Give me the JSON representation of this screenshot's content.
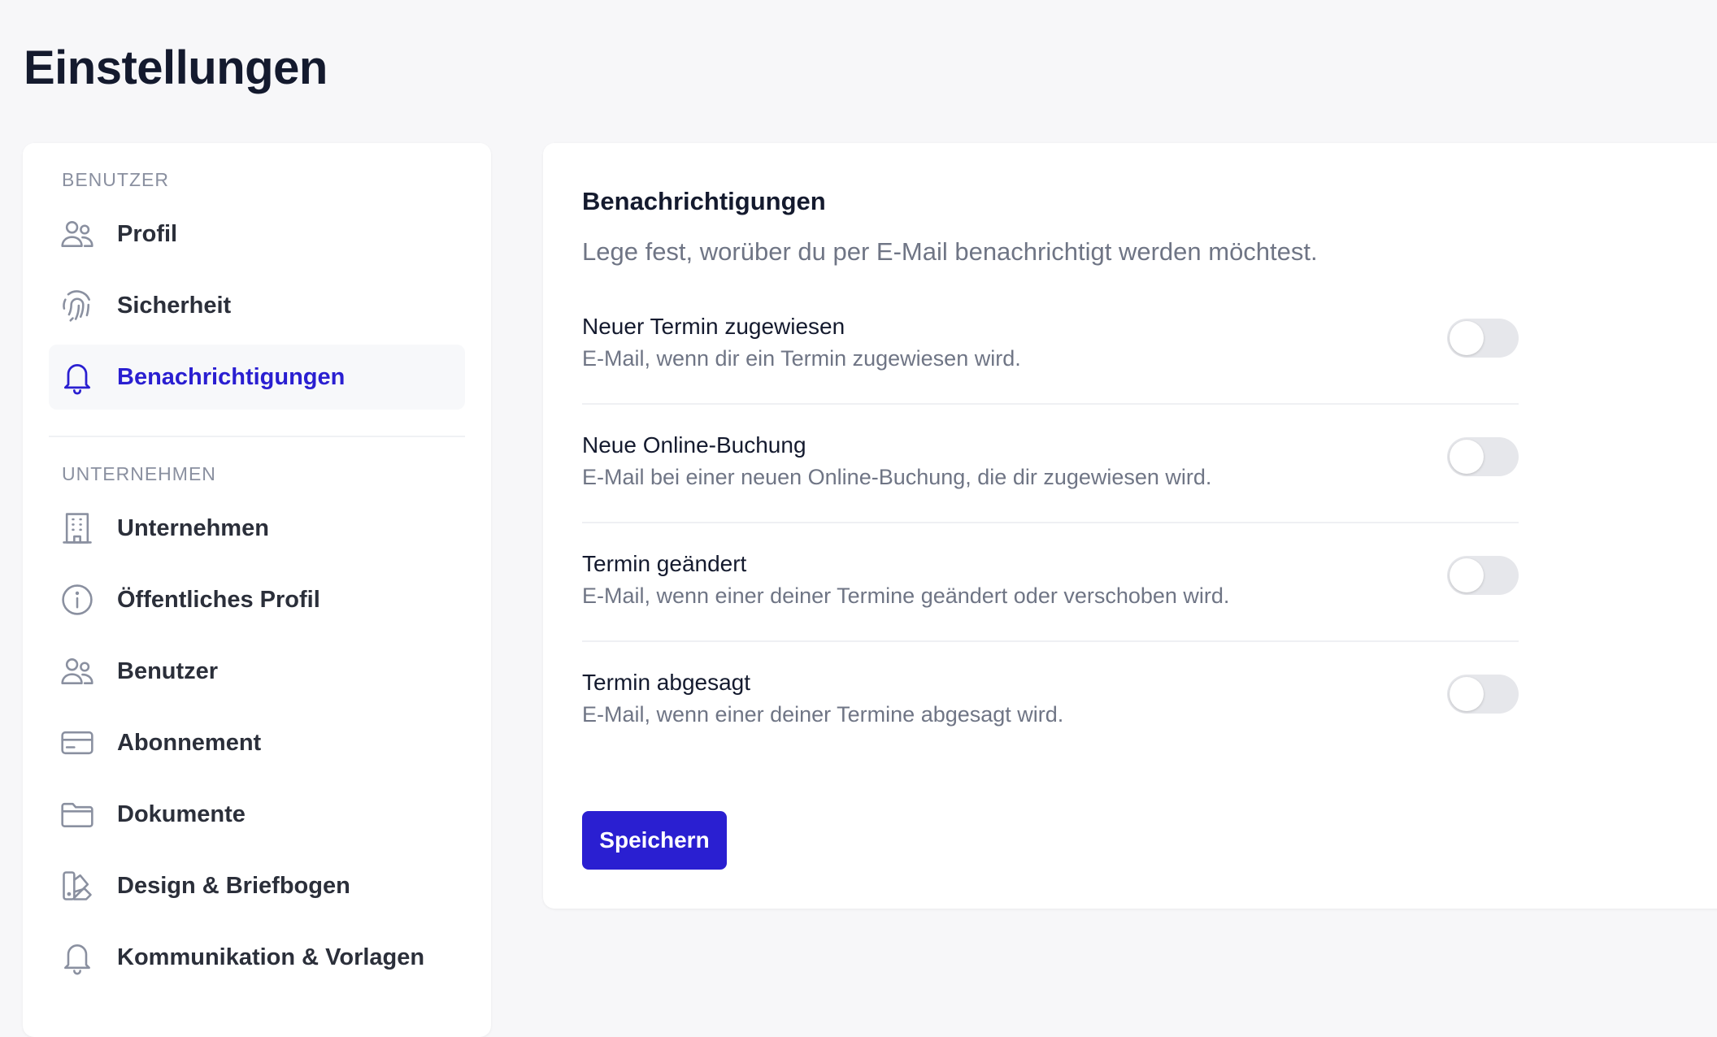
{
  "page": {
    "title": "Einstellungen"
  },
  "sidebar": {
    "sections": [
      {
        "label": "BENUTZER",
        "items": [
          {
            "label": "Profil",
            "icon": "users-icon",
            "active": false
          },
          {
            "label": "Sicherheit",
            "icon": "fingerprint-icon",
            "active": false
          },
          {
            "label": "Benachrichtigungen",
            "icon": "bell-icon",
            "active": true
          }
        ]
      },
      {
        "label": "UNTERNEHMEN",
        "items": [
          {
            "label": "Unternehmen",
            "icon": "building-icon",
            "active": false
          },
          {
            "label": "Öffentliches Profil",
            "icon": "info-icon",
            "active": false
          },
          {
            "label": "Benutzer",
            "icon": "users-icon",
            "active": false
          },
          {
            "label": "Abonnement",
            "icon": "credit-card-icon",
            "active": false
          },
          {
            "label": "Dokumente",
            "icon": "folder-icon",
            "active": false
          },
          {
            "label": "Design & Briefbogen",
            "icon": "swatch-icon",
            "active": false
          },
          {
            "label": "Kommunikation & Vorlagen",
            "icon": "bell-icon",
            "active": false
          }
        ]
      }
    ]
  },
  "panel": {
    "title": "Benachrichtigungen",
    "subtitle": "Lege fest, worüber du per E-Mail benachrichtigt werden möchtest.",
    "settings": [
      {
        "title": "Neuer Termin zugewiesen",
        "description": "E-Mail, wenn dir ein Termin zugewiesen wird.",
        "enabled": false
      },
      {
        "title": "Neue Online-Buchung",
        "description": "E-Mail bei einer neuen Online-Buchung, die dir zugewiesen wird.",
        "enabled": false
      },
      {
        "title": "Termin geändert",
        "description": "E-Mail, wenn einer deiner Termine geändert oder verschoben wird.",
        "enabled": false
      },
      {
        "title": "Termin abgesagt",
        "description": "E-Mail, wenn einer deiner Termine abgesagt wird.",
        "enabled": false
      }
    ],
    "save_label": "Speichern"
  },
  "colors": {
    "accent": "#2a1fd1",
    "background": "#f7f7f9",
    "card": "#ffffff",
    "muted_text": "#6f7585",
    "toggle_off": "#e6e7eb"
  }
}
